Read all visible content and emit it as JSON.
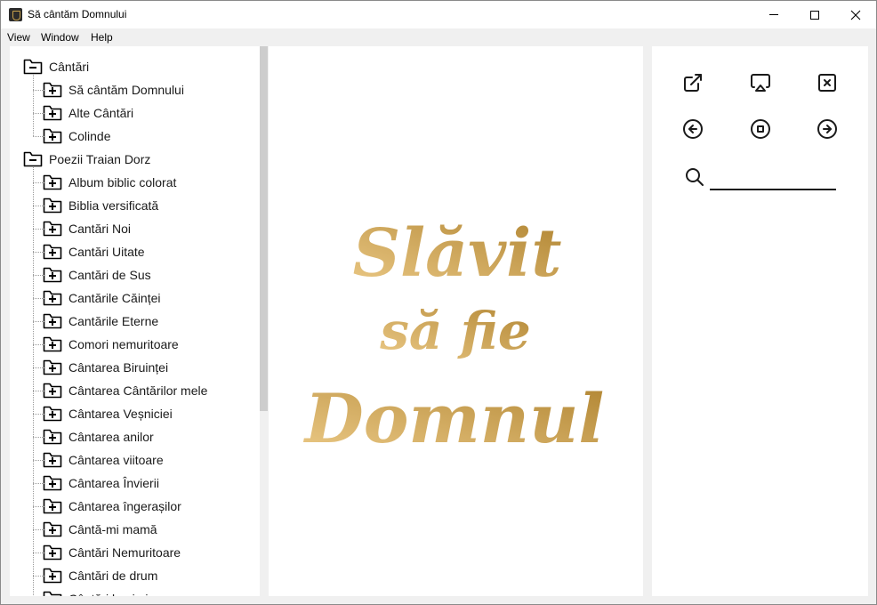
{
  "window": {
    "title": "Să cântăm Domnului"
  },
  "menu": [
    "View",
    "Window",
    "Help"
  ],
  "tree": [
    {
      "label": "Cântări",
      "state": "expanded",
      "level": 0
    },
    {
      "label": "Să cântăm Domnului",
      "state": "collapsed",
      "level": 1
    },
    {
      "label": "Alte Cântări",
      "state": "collapsed",
      "level": 1
    },
    {
      "label": "Colinde",
      "state": "collapsed",
      "level": 1
    },
    {
      "label": "Poezii Traian Dorz",
      "state": "expanded",
      "level": 0
    },
    {
      "label": "Album biblic colorat",
      "state": "collapsed",
      "level": 1
    },
    {
      "label": "Biblia versificată",
      "state": "collapsed",
      "level": 1
    },
    {
      "label": "Cantări Noi",
      "state": "collapsed",
      "level": 1
    },
    {
      "label": "Cantări Uitate",
      "state": "collapsed",
      "level": 1
    },
    {
      "label": "Cantări de Sus",
      "state": "collapsed",
      "level": 1
    },
    {
      "label": "Cantările Căinței",
      "state": "collapsed",
      "level": 1
    },
    {
      "label": "Cantările Eterne",
      "state": "collapsed",
      "level": 1
    },
    {
      "label": "Comori nemuritoare",
      "state": "collapsed",
      "level": 1
    },
    {
      "label": "Cântarea Biruinței",
      "state": "collapsed",
      "level": 1
    },
    {
      "label": "Cântarea Cântărilor mele",
      "state": "collapsed",
      "level": 1
    },
    {
      "label": "Cântarea Veșniciei",
      "state": "collapsed",
      "level": 1
    },
    {
      "label": "Cântarea anilor",
      "state": "collapsed",
      "level": 1
    },
    {
      "label": "Cântarea viitoare",
      "state": "collapsed",
      "level": 1
    },
    {
      "label": "Cântarea Învierii",
      "state": "collapsed",
      "level": 1
    },
    {
      "label": "Cântarea îngerașilor",
      "state": "collapsed",
      "level": 1
    },
    {
      "label": "Cântă-mi mamă",
      "state": "collapsed",
      "level": 1
    },
    {
      "label": "Cântări Nemuritoare",
      "state": "collapsed",
      "level": 1
    },
    {
      "label": "Cântări de drum",
      "state": "collapsed",
      "level": 1
    },
    {
      "label": "Cântări lacrimi",
      "state": "collapsed",
      "level": 1
    }
  ],
  "logo": {
    "lines": [
      "Slăvit",
      "să fie",
      "Domnul"
    ],
    "color_light": "#ecca87",
    "color_dark": "#b08431"
  },
  "tools": [
    {
      "name": "external-link-icon"
    },
    {
      "name": "cast-icon"
    },
    {
      "name": "close-box-icon"
    },
    {
      "name": "arrow-left-circle-icon"
    },
    {
      "name": "stop-circle-icon"
    },
    {
      "name": "arrow-right-circle-icon"
    }
  ],
  "search": {
    "value": "",
    "placeholder": ""
  }
}
